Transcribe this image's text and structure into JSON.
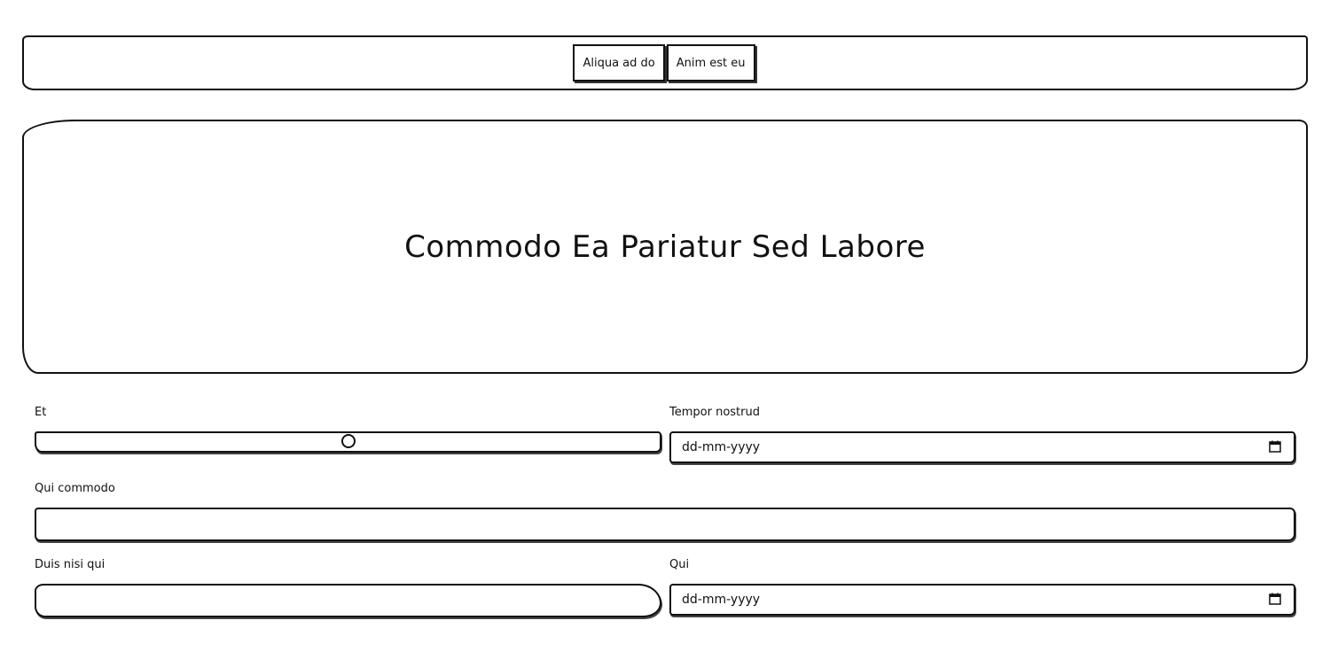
{
  "navbar": {
    "buttons": [
      {
        "label": "Aliqua ad do"
      },
      {
        "label": "Anim est eu"
      }
    ]
  },
  "hero": {
    "title": "Commodo Ea Pariatur Sed Labore"
  },
  "form": {
    "et": {
      "label": "Et",
      "slider_value": 0.5
    },
    "tempor_nostrud": {
      "label": "Tempor nostrud",
      "placeholder": "dd-mm-yyyy",
      "icon": "calendar-icon"
    },
    "qui_commodo": {
      "label": "Qui commodo",
      "value": ""
    },
    "duis_nisi_qui": {
      "label": "Duis nisi qui",
      "value": ""
    },
    "qui": {
      "label": "Qui",
      "placeholder": "dd-mm-yyyy",
      "icon": "calendar-icon"
    }
  }
}
